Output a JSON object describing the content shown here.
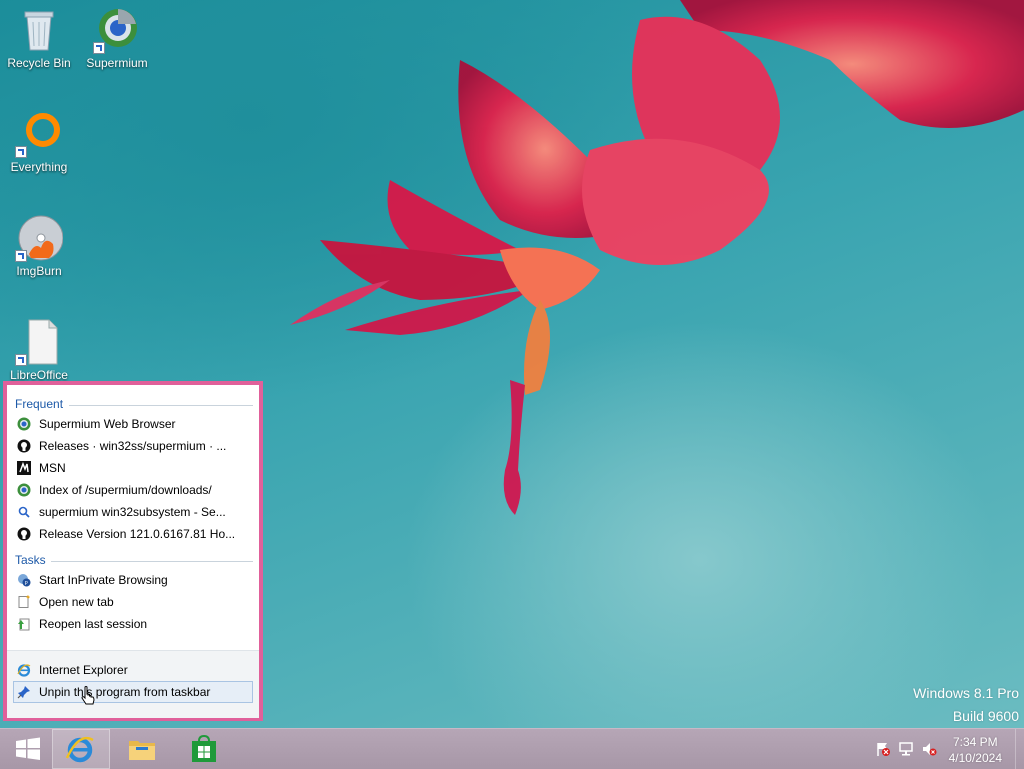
{
  "desktop": {
    "icons": [
      {
        "label": "Recycle Bin",
        "icon": "recycle-bin-icon"
      },
      {
        "label": "Supermium",
        "icon": "supermium-icon"
      },
      {
        "label": "Everything",
        "icon": "everything-icon"
      },
      {
        "label": "ImgBurn",
        "icon": "imgburn-icon"
      },
      {
        "label": "LibreOffice",
        "icon": "libreoffice-icon"
      }
    ],
    "watermark": {
      "line1": "Windows 8.1 Pro",
      "line2": "Build 9600"
    }
  },
  "jumplist": {
    "frequent_header": "Frequent",
    "frequent": [
      {
        "label": "Supermium Web Browser",
        "icon": "supermium-icon"
      },
      {
        "label": "Releases · win32ss/supermium · ...",
        "icon": "github-icon"
      },
      {
        "label": "MSN",
        "icon": "msn-icon"
      },
      {
        "label": "Index of /supermium/downloads/",
        "icon": "supermium-icon"
      },
      {
        "label": "supermium win32subsystem - Se...",
        "icon": "search-icon"
      },
      {
        "label": "Release Version 121.0.6167.81 Ho...",
        "icon": "github-icon"
      }
    ],
    "tasks_header": "Tasks",
    "tasks": [
      {
        "label": "Start InPrivate Browsing",
        "icon": "inprivate-icon"
      },
      {
        "label": "Open new tab",
        "icon": "new-tab-icon"
      },
      {
        "label": "Reopen last session",
        "icon": "reopen-session-icon"
      }
    ],
    "program": {
      "label": "Internet Explorer",
      "icon": "internet-explorer-icon"
    },
    "unpin": {
      "label": "Unpin this program from taskbar",
      "icon": "unpin-icon"
    }
  },
  "taskbar": {
    "start": "start-windows-icon",
    "pinned": [
      "internet-explorer-icon",
      "file-explorer-icon",
      "store-icon"
    ],
    "tray": [
      "action-center-flag-icon",
      "network-icon",
      "volume-muted-icon"
    ],
    "clock": {
      "time": "7:34 PM",
      "date": "4/10/2024"
    }
  },
  "colors": {
    "accent": "#e0609a",
    "taskbar": "#b0a0b0",
    "jump_header": "#1e5aa8"
  }
}
